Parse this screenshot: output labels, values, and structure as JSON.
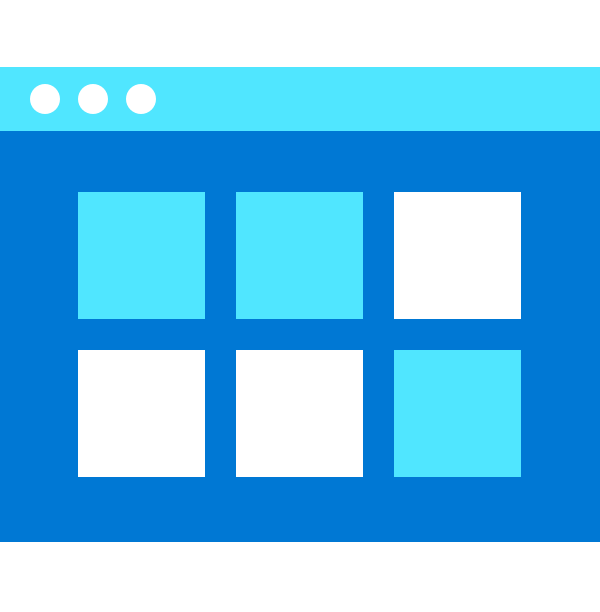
{
  "icon": "app-grid-window-icon",
  "colors": {
    "titlebar": "#50e6ff",
    "content": "#0078d4",
    "dot": "#ffffff",
    "tile_light": "#50e6ff",
    "tile_white": "#ffffff"
  },
  "tiles": [
    {
      "color": "#50e6ff"
    },
    {
      "color": "#50e6ff"
    },
    {
      "color": "#ffffff"
    },
    {
      "color": "#ffffff"
    },
    {
      "color": "#ffffff"
    },
    {
      "color": "#50e6ff"
    }
  ]
}
